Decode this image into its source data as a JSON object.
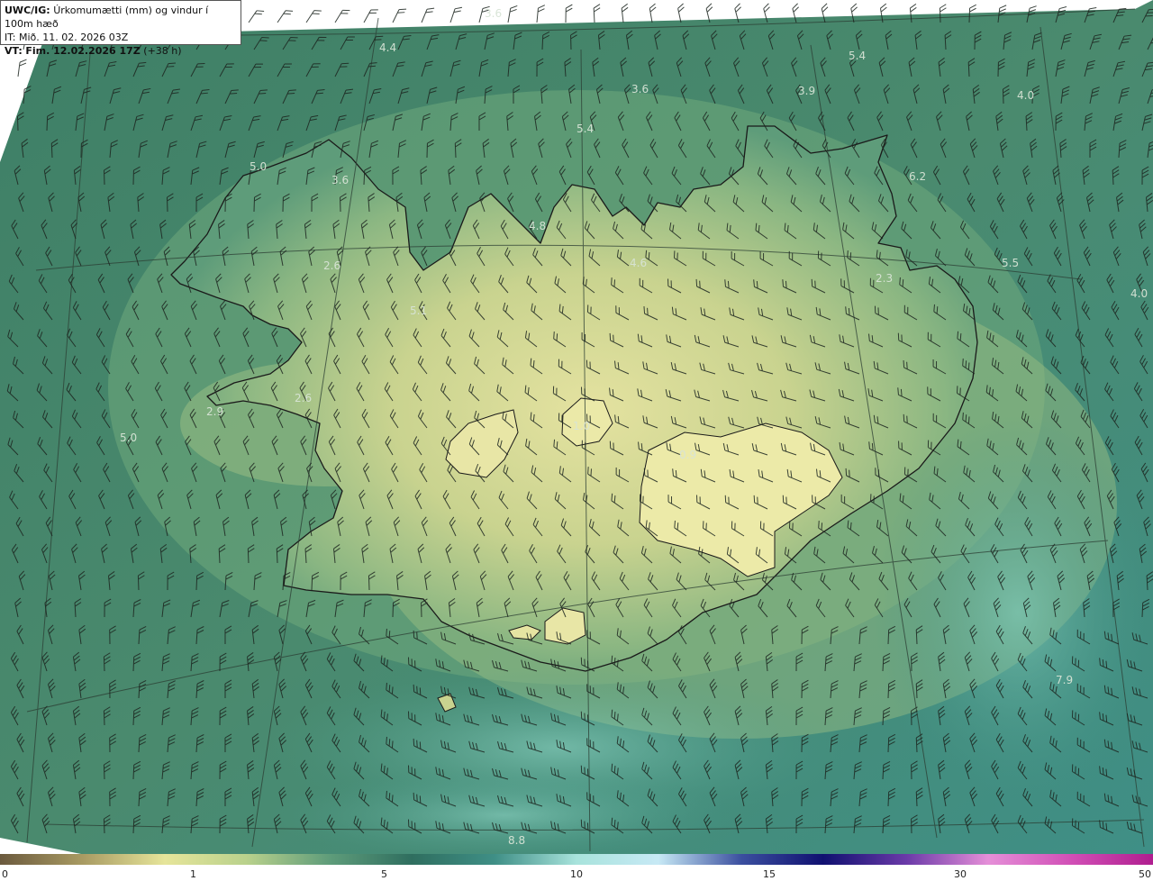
{
  "header": {
    "code": "UWC/IG:",
    "title": "Úrkomumætti (mm) og vindur í 100m hæð",
    "it_label": "IT:",
    "it_value": "Mið. 11. 02. 2026 03Z",
    "vt_label": "VT:",
    "vt_value": "Fim. 12.02.2026 17Z",
    "vt_suffix": "(+38 h)"
  },
  "values": [
    {
      "text": "3.6",
      "id": "v1"
    },
    {
      "text": "4.4",
      "id": "v2"
    },
    {
      "text": "5.4",
      "id": "v3"
    },
    {
      "text": "3.6",
      "id": "v4"
    },
    {
      "text": "3.9",
      "id": "v5"
    },
    {
      "text": "4.0",
      "id": "v6"
    },
    {
      "text": "5.4",
      "id": "v7"
    },
    {
      "text": "5.0",
      "id": "v8"
    },
    {
      "text": "6.2",
      "id": "v9"
    },
    {
      "text": "3.6",
      "id": "v10"
    },
    {
      "text": "4.8",
      "id": "v11"
    },
    {
      "text": "4.6",
      "id": "v12"
    },
    {
      "text": "2.6",
      "id": "v13"
    },
    {
      "text": "5.5",
      "id": "v14"
    },
    {
      "text": "2.3",
      "id": "v15"
    },
    {
      "text": "4.0",
      "id": "v16"
    },
    {
      "text": "5.1",
      "id": "v17"
    },
    {
      "text": "2.6",
      "id": "v18"
    },
    {
      "text": "2.9",
      "id": "v19"
    },
    {
      "text": "5.0",
      "id": "v20"
    },
    {
      "text": "1.0",
      "id": "v21"
    },
    {
      "text": "0.9",
      "id": "v22"
    },
    {
      "text": "7.9",
      "id": "v23"
    },
    {
      "text": "8.8",
      "id": "v24"
    }
  ],
  "colorbar": {
    "ticks": [
      "0",
      "1",
      "5",
      "10",
      "15",
      "30",
      "50"
    ],
    "colors": [
      "#6b5a3e",
      "#a89a62",
      "#e6e59a",
      "#b9d18c",
      "#5e9c7a",
      "#2f6e5f",
      "#3f8f86",
      "#a8e3dc",
      "#c7e9f5",
      "#3b4f9f",
      "#101070",
      "#6a3aa8",
      "#e58fd8",
      "#d14fb6",
      "#b01e8f"
    ]
  }
}
